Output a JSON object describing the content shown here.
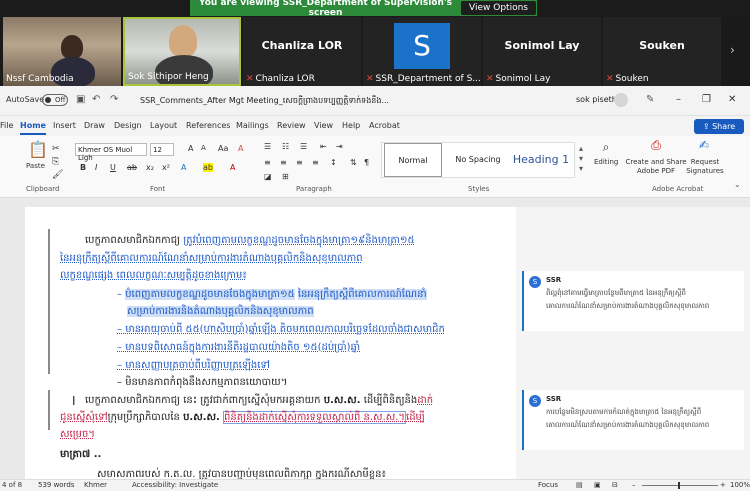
{
  "zoom": {
    "banner_text": "You are viewing SSR_Department of Supervision's screen",
    "view_options": "View Options",
    "participants": [
      {
        "name": "Nssf Cambodia",
        "video": true,
        "muted": false
      },
      {
        "name": "Sok Sithipor Heng",
        "video": true,
        "muted": false
      },
      {
        "name": "Chanliza LOR",
        "big_name": "Chanliza LOR",
        "video": false,
        "muted": true
      },
      {
        "name": "SSR_Department of S...",
        "initial": "S",
        "video": false,
        "muted": true
      },
      {
        "name": "Sonimol Lay",
        "big_name": "Sonimol Lay",
        "video": false,
        "muted": true
      },
      {
        "name": "Souken",
        "big_name": "Souken",
        "video": false,
        "muted": true
      }
    ]
  },
  "word": {
    "autosave_label": "AutoSave",
    "autosave_state": "Off",
    "doc_title": "SSR_Comments_After Mgt Meeting_សេចក្តីព្រាងបទប្បញ្ញត្តិទាក់ទងនឹង...",
    "user_name": "sok piseth",
    "tabs": [
      "File",
      "Home",
      "Insert",
      "Draw",
      "Design",
      "Layout",
      "References",
      "Mailings",
      "Review",
      "View",
      "Help",
      "Acrobat"
    ],
    "share_label": "Share",
    "ribbon": {
      "paste_label": "Paste",
      "clipboard_group": "Clipboard",
      "font_name": "Khmer OS Muol Ligh",
      "font_size": "12",
      "font_group": "Font",
      "paragraph_group": "Paragraph",
      "styles_group": "Styles",
      "styles": [
        "Normal",
        "No Spacing",
        "Heading 1"
      ],
      "editing_label": "Editing",
      "create_share_pdf": "Create and Share Adobe PDF",
      "request_signatures": "Request Signatures",
      "acrobat_group": "Adobe Acrobat"
    },
    "document": {
      "p1_line1_a": "បេក្ខភាពសមាជិកឯកកាជ្យ",
      "p1_line1_b": "ត្រូវបំពេញតាមលក្ខខណ្ឌដូចមានចែងក្នុងមាត្រា១៩និងមាត្រា១៥",
      "p1_line2": "នៃអនុក្រឹត្យស្តីពីគោលការណ៍ណែនាំសម្រាប់ការងារតំណាងបុគ្គលិកនិងសុខុមាលភាព",
      "p1_line3": "លក្ខខណ្ឌផ្សេង ពេលលក្ខណៈសម្បត្តិដូចខាងក្រោម៖",
      "bullet1a": "បំពេញតាមលក្ខខណ្ឌដូចមានចែងក្នុងមាត្រា១៥",
      "bullet1b": "នៃអនុក្រឹត្យស្តីពីគោលការណ៍ណែនាំ",
      "bullet1c": "សម្រាប់ការងារនិងតំណាងបុគ្គលិកនិងសុខុមាលភាព",
      "bullet2": "មានអាយុចាប់ពី ៥៥(ហាសិបប្រាំ)ឆ្នាំឡើង តិចមកពេលកាលបរិច្ឆេទដែលចាំងជាសមាជិក",
      "bullet3": "មានបទពិសោធន៍ក្នុងការងារនីតិរដ្ឋបាលយ៉ាងតិច ១៥(ដប់ប្រាំ)ឆ្នាំ",
      "bullet4": "មានសញ្ញាបត្រចាប់ពីបរិញ្ញាបត្រឡើងទៅ",
      "bullet5": "មិនមានភាពកំពុងនឹងសកម្មភាពនយោបាយ។",
      "p2_line1_a": "បេក្ខភាពសមាជិកឯកកាជ្យ នេះ ត្រូវជាក់ពាក្យស្នើសុំមកអគ្គនាយក",
      "p2_line1_b": "ប.ស.ស.",
      "p2_line1_c": "ដើម្បីពិនិត្យនិង",
      "p2_line1_d": "ដាក់",
      "p2_line2_a": "ជូនស្នើសុំទៅ",
      "p2_line2_b": "ក្រុមប្រឹក្សាភិបាលនៃ",
      "p2_line2_c": "ប.ស.ស.",
      "p2_line2_d": "ពិនិត្យនិងដាក់ស្នើសុំការទទួលស្គាល់ពី ន.ស.ស.។",
      "p2_line2_e": "ដើម្បី",
      "p2_line3": "សម្រេច។",
      "heading": "មាត្រា៧ ..",
      "p3_line1": "សមាសភាពរបស់ ក.ត.ល. ត្រូវបានបញ្ជាប់មុនពេលពិភាក្សា ក្នុងករណីសាមីខ្លួន៖"
    },
    "comments": [
      {
        "author": "SSR",
        "initial": "S",
        "line1": "ពិល្អពុំនៅតាមធ្វើមាត្រាបន្ថែមពីមាត្រា៥ នៃអនុក្រឹត្យស្តីពី",
        "line2": "គោលការណ៍ណែនាំសម្រាប់ការងារតំណាងបុគ្គលិកសុខុមាលភាព"
      },
      {
        "author": "SSR",
        "initial": "S",
        "line1": "ការបន្ថែមមិនស្របតាមការកំណត់ក្នុងមាត្រា៥ នៃអនុក្រឹត្យស្តីពី",
        "line2": "គោលការណ៍ណែនាំសម្រាប់ការងារតំណាងបុគ្គលិកសុខុមាលភាព"
      }
    ],
    "status": {
      "page": "4 of 8",
      "words": "539 words",
      "language": "Khmer",
      "accessibility": "Accessibility: Investigate",
      "focus": "Focus",
      "zoom": "100%"
    }
  },
  "colors": {
    "accent": "#185abd",
    "banner": "#2d8a3a",
    "tracked_blue": "#1e59c8",
    "tracked_red": "#c11f47"
  }
}
